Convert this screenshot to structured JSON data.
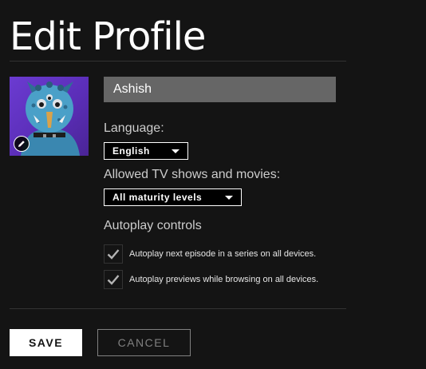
{
  "page": {
    "title": "Edit Profile"
  },
  "profile": {
    "name": "Ashish",
    "avatar_icon": "troll-character-avatar",
    "edit_icon": "pencil-icon"
  },
  "language": {
    "label": "Language:",
    "selected": "English"
  },
  "maturity": {
    "label": "Allowed TV shows and movies:",
    "selected": "All maturity levels"
  },
  "autoplay": {
    "label": "Autoplay controls",
    "options": [
      {
        "label": "Autoplay next episode in a series on all devices.",
        "checked": true
      },
      {
        "label": "Autoplay previews while browsing on all devices.",
        "checked": true
      }
    ]
  },
  "actions": {
    "save_label": "SAVE",
    "cancel_label": "CANCEL"
  },
  "colors": {
    "background": "#141414",
    "input_bg": "#666666",
    "avatar_bg": "#5b2eb8",
    "save_bg": "#ffffff",
    "cancel_border": "#808080"
  }
}
